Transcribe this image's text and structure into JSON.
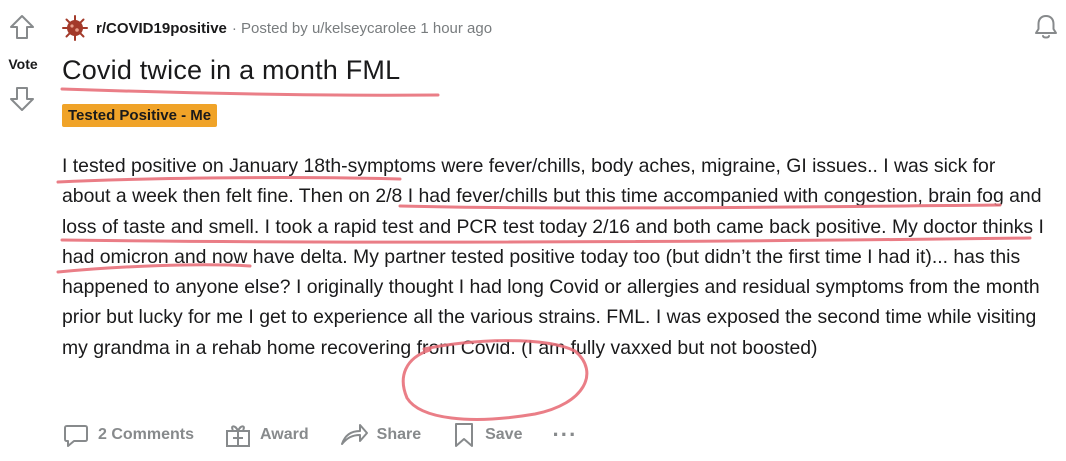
{
  "post": {
    "vote_label": "Vote",
    "subreddit": "r/COVID19positive",
    "posted_by_prefix": "· Posted by",
    "author": "u/kelseycarolee",
    "time": "1 hour ago",
    "title": "Covid twice in a month FML",
    "flair": "Tested Positive - Me",
    "body": "I tested positive on January 18th-symptoms were fever/chills, body aches, migraine, GI issues.. I was sick for about a week then felt fine. Then on 2/8 I had fever/chills but this time accompanied with congestion, brain fog and loss of taste and smell. I took a rapid test and PCR test today 2/16 and both came back positive. My doctor thinks I had omicron and now have delta. My partner tested positive today too (but didn’t the first time I had it)... has this happened to anyone else? I originally thought I had long Covid or allergies and residual symptoms from the month prior but lucky for me I get to experience all the various strains. FML. I was exposed the second time while visiting my grandma in a rehab home recovering from Covid. (I am fully vaxxed but not boosted)"
  },
  "actions": {
    "comments": "2 Comments",
    "award": "Award",
    "share": "Share",
    "save": "Save",
    "more": "···"
  },
  "colors": {
    "flair_bg": "#f0a328",
    "annotation": "#e8707a",
    "muted": "#787c7e"
  },
  "icons": [
    "upvote-arrow-icon",
    "downvote-arrow-icon",
    "subreddit-icon",
    "bell-icon",
    "comment-icon",
    "award-icon",
    "share-icon",
    "save-icon",
    "more-icon"
  ]
}
